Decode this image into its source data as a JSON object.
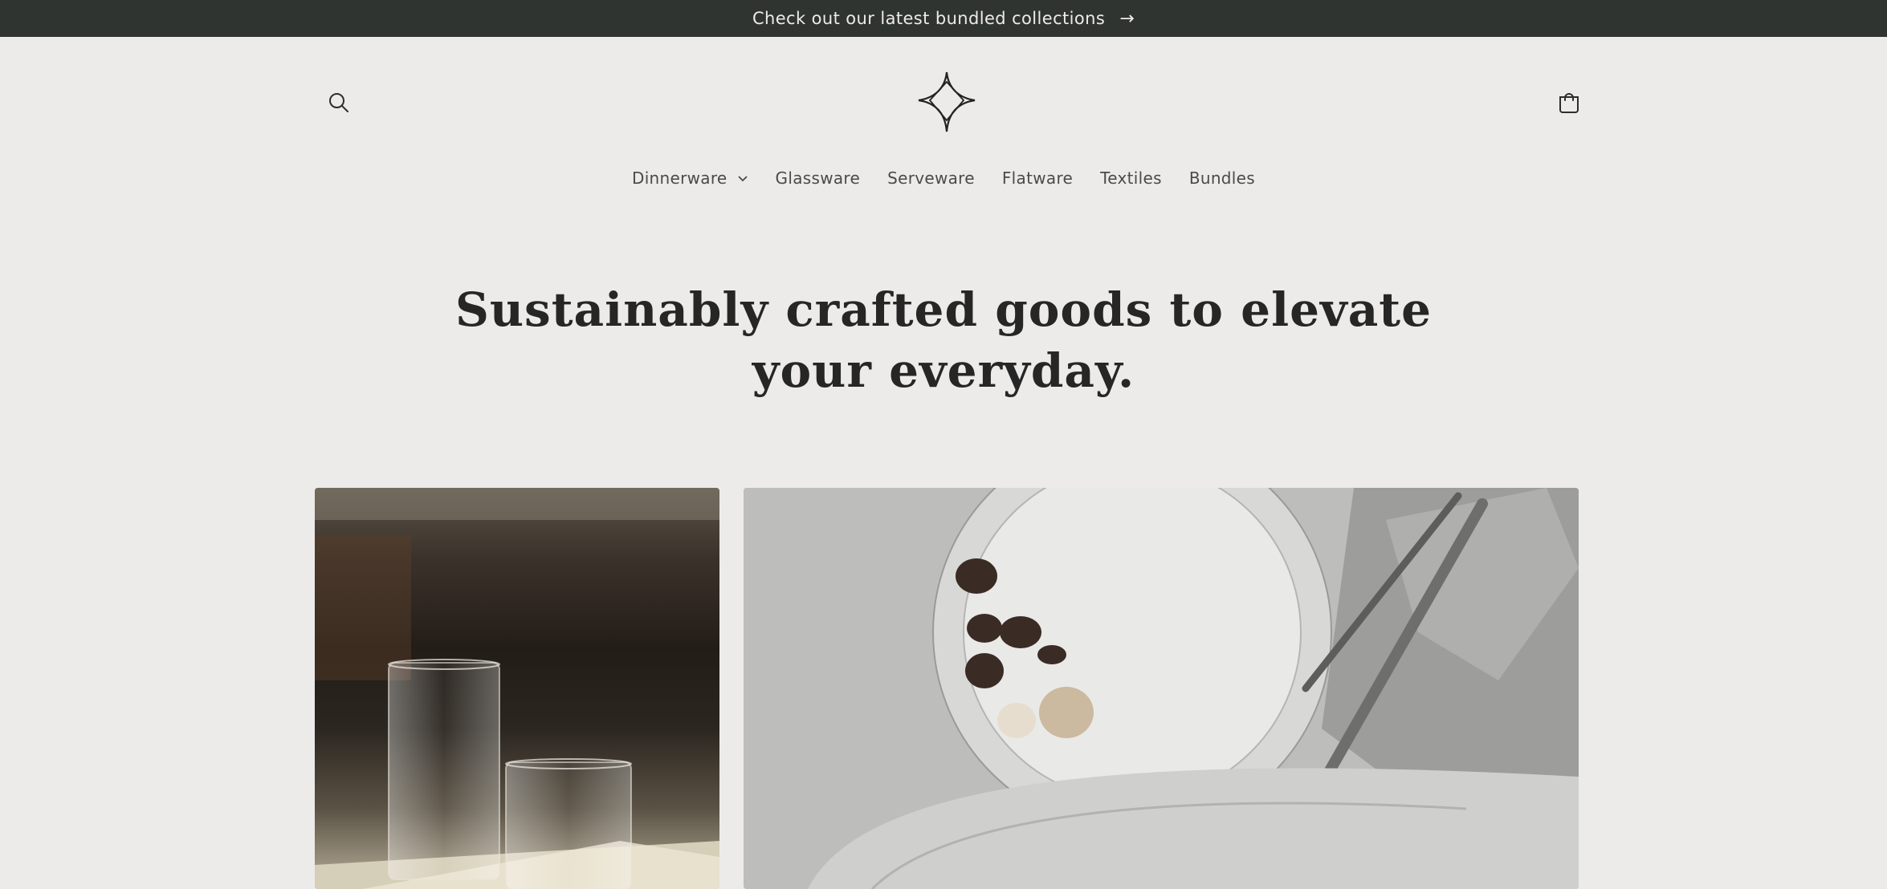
{
  "announcement": {
    "text": "Check out our latest bundled collections",
    "arrow": "→"
  },
  "header": {
    "search_icon": "search-icon",
    "logo_icon": "four-point-star-logo",
    "cart_icon": "shopping-bag-icon"
  },
  "nav": {
    "items": [
      {
        "label": "Dinnerware",
        "has_dropdown": true
      },
      {
        "label": "Glassware"
      },
      {
        "label": "Serveware"
      },
      {
        "label": "Flatware"
      },
      {
        "label": "Textiles"
      },
      {
        "label": "Bundles"
      }
    ]
  },
  "hero": {
    "title_line1": "Sustainably crafted goods to elevate",
    "title_line2": "your everyday."
  },
  "colors": {
    "announcement_bg": "#2f3430",
    "page_bg": "#ecebea",
    "text": "#262626"
  }
}
